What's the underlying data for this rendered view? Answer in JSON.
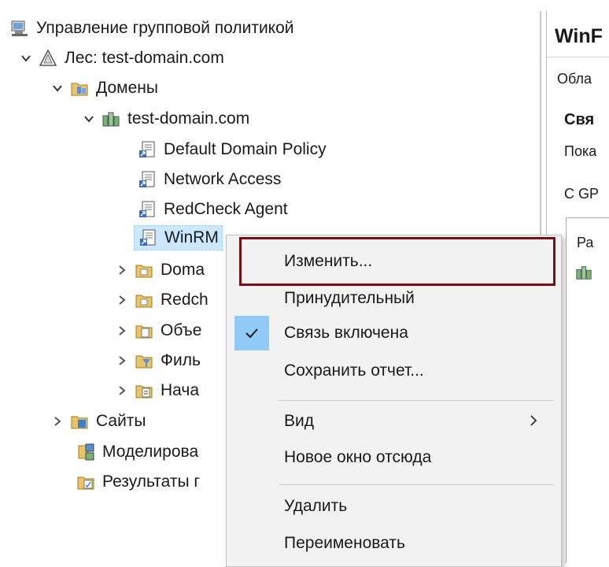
{
  "tree": {
    "root": "Управление групповой политикой",
    "forest": "Лес: test-domain.com",
    "domains": "Домены",
    "domain": "test-domain.com",
    "gpos": [
      "Default Domain Policy",
      "Network Access",
      "RedCheck Agent"
    ],
    "selected": "WinRM",
    "children": [
      "Doma",
      "Redch",
      "Объе",
      "Филь",
      "Нача"
    ],
    "sites": "Сайты",
    "modeling": "Моделирова",
    "results": "Результаты г"
  },
  "right_pane": {
    "title": "WinF",
    "tab": "Обла",
    "heading": "Свя",
    "line1": "Пока",
    "line2": "C GP",
    "box_label": "Ра"
  },
  "context_menu": {
    "items": [
      {
        "label": "Изменить..."
      },
      {
        "label": "Принудительный"
      },
      {
        "label": "Связь включена",
        "checked": true
      },
      {
        "label": "Сохранить отчет..."
      },
      {
        "label": "Вид",
        "submenu": true
      },
      {
        "label": "Новое окно отсюда"
      },
      {
        "label": "Удалить"
      },
      {
        "label": "Переименовать"
      }
    ],
    "highlight_color": "#7b0d18",
    "check_bg_color": "#91c9f7"
  }
}
